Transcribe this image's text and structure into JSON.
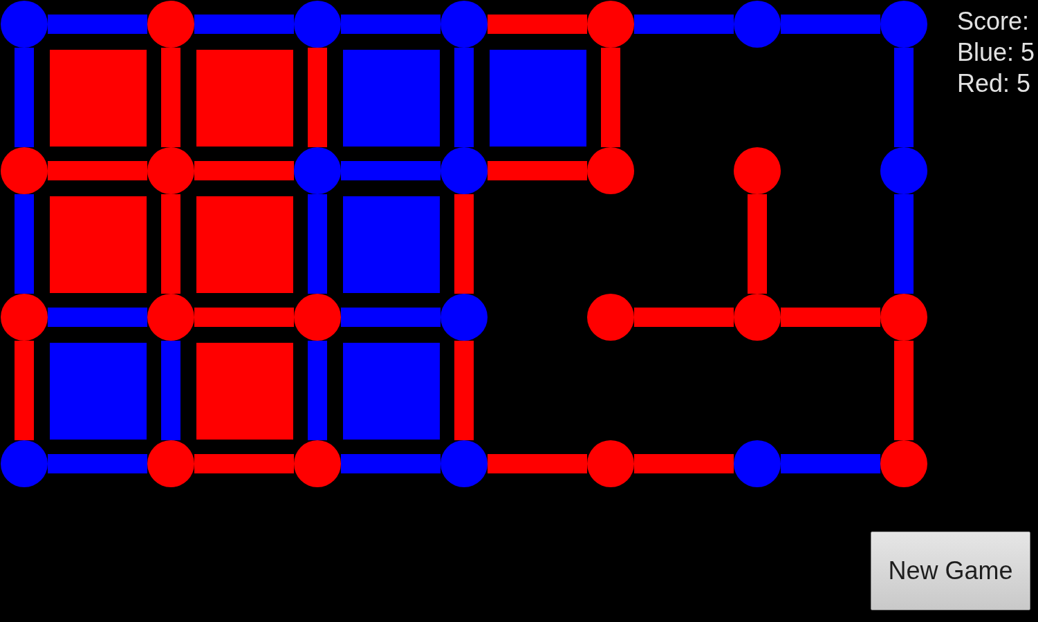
{
  "board": {
    "dots": [
      [
        {
          "color": "#0000ff"
        },
        {
          "color": "#ff0000"
        },
        {
          "color": "#0000ff"
        },
        {
          "color": "#0000ff"
        },
        {
          "color": "#ff0000"
        },
        {
          "color": "#0000ff"
        },
        {
          "color": "#0000ff"
        }
      ],
      [
        {
          "color": "#ff0000"
        },
        {
          "color": "#ff0000"
        },
        {
          "color": "#0000ff"
        },
        {
          "color": "#0000ff"
        },
        {
          "color": "#ff0000"
        },
        {
          "color": "#ff0000"
        },
        {
          "color": "#0000ff"
        }
      ],
      [
        {
          "color": "#ff0000"
        },
        {
          "color": "#ff0000"
        },
        {
          "color": "#ff0000"
        },
        {
          "color": "#0000ff"
        },
        {
          "color": "#ff0000"
        },
        {
          "color": "#ff0000"
        },
        {
          "color": "#ff0000"
        }
      ],
      [
        {
          "color": "#0000ff"
        },
        {
          "color": "#ff0000"
        },
        {
          "color": "#ff0000"
        },
        {
          "color": "#0000ff"
        },
        {
          "color": "#ff0000"
        },
        {
          "color": "#0000ff"
        },
        {
          "color": "#ff0000"
        }
      ]
    ],
    "horizontal_lines": [
      [
        {
          "kind": "line",
          "color": "#0000ff"
        },
        {
          "kind": "line",
          "color": "#0000ff"
        },
        {
          "kind": "line",
          "color": "#0000ff"
        },
        {
          "kind": "line",
          "color": "#ff0000"
        },
        {
          "kind": "line",
          "color": "#0000ff"
        },
        {
          "kind": "line",
          "color": "#0000ff"
        }
      ],
      [
        {
          "kind": "line",
          "color": "#ff0000"
        },
        {
          "kind": "line",
          "color": "#ff0000"
        },
        {
          "kind": "line",
          "color": "#0000ff"
        },
        {
          "kind": "line",
          "color": "#ff0000"
        },
        {
          "kind": "gap"
        },
        {
          "kind": "gap"
        }
      ],
      [
        {
          "kind": "line",
          "color": "#0000ff"
        },
        {
          "kind": "line",
          "color": "#ff0000"
        },
        {
          "kind": "line",
          "color": "#0000ff"
        },
        {
          "kind": "gap"
        },
        {
          "kind": "line",
          "color": "#ff0000"
        },
        {
          "kind": "line",
          "color": "#ff0000"
        }
      ],
      [
        {
          "kind": "line",
          "color": "#0000ff"
        },
        {
          "kind": "line",
          "color": "#ff0000"
        },
        {
          "kind": "line",
          "color": "#0000ff"
        },
        {
          "kind": "line",
          "color": "#ff0000"
        },
        {
          "kind": "line",
          "color": "#ff0000"
        },
        {
          "kind": "line",
          "color": "#0000ff"
        }
      ]
    ],
    "vertical_lines": [
      [
        {
          "kind": "line",
          "color": "#0000ff"
        },
        {
          "kind": "line",
          "color": "#ff0000"
        },
        {
          "kind": "line",
          "color": "#ff0000"
        },
        {
          "kind": "line",
          "color": "#0000ff"
        },
        {
          "kind": "line",
          "color": "#ff0000"
        },
        {
          "kind": "gap"
        },
        {
          "kind": "line",
          "color": "#0000ff"
        }
      ],
      [
        {
          "kind": "line",
          "color": "#0000ff"
        },
        {
          "kind": "line",
          "color": "#ff0000"
        },
        {
          "kind": "line",
          "color": "#0000ff"
        },
        {
          "kind": "line",
          "color": "#ff0000"
        },
        {
          "kind": "gap"
        },
        {
          "kind": "line",
          "color": "#ff0000"
        },
        {
          "kind": "line",
          "color": "#0000ff"
        }
      ],
      [
        {
          "kind": "line",
          "color": "#ff0000"
        },
        {
          "kind": "line",
          "color": "#0000ff"
        },
        {
          "kind": "line",
          "color": "#0000ff"
        },
        {
          "kind": "line",
          "color": "#ff0000"
        },
        {
          "kind": "gap"
        },
        {
          "kind": "gap"
        },
        {
          "kind": "line",
          "color": "#ff0000"
        }
      ]
    ],
    "boxes": [
      [
        {
          "kind": "claimed",
          "color": "#ff0000"
        },
        {
          "kind": "claimed",
          "color": "#ff0000"
        },
        {
          "kind": "claimed",
          "color": "#0000ff"
        },
        {
          "kind": "claimed",
          "color": "#0000ff"
        },
        {
          "kind": "open"
        },
        {
          "kind": "open"
        }
      ],
      [
        {
          "kind": "claimed",
          "color": "#ff0000"
        },
        {
          "kind": "claimed",
          "color": "#ff0000"
        },
        {
          "kind": "claimed",
          "color": "#0000ff"
        },
        {
          "kind": "open"
        },
        {
          "kind": "open"
        },
        {
          "kind": "open"
        }
      ],
      [
        {
          "kind": "claimed",
          "color": "#0000ff"
        },
        {
          "kind": "claimed",
          "color": "#ff0000"
        },
        {
          "kind": "claimed",
          "color": "#0000ff"
        },
        {
          "kind": "open"
        },
        {
          "kind": "open"
        },
        {
          "kind": "open"
        }
      ]
    ]
  },
  "score": {
    "title": "Score:",
    "lines": [
      "Blue: 5",
      "Red: 5"
    ]
  },
  "new_game_button": {
    "label": "New Game"
  }
}
